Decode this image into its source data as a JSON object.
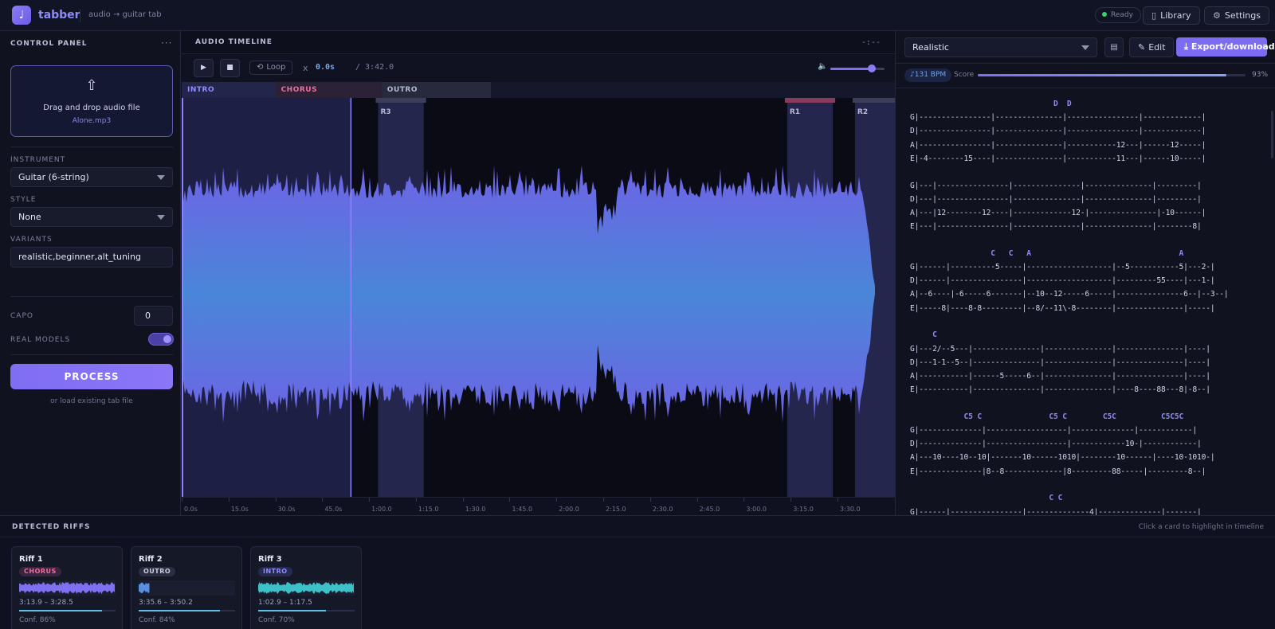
{
  "app": {
    "logo_glyph": "♩",
    "name": "tabber",
    "subtitle": "audio → guitar tab",
    "status": "Ready",
    "library_label": "Library",
    "settings_label": "Settings",
    "library_icon": "book-icon",
    "settings_icon": "gear-icon"
  },
  "control_panel": {
    "title": "CONTROL PANEL",
    "menu": "···",
    "dropzone_icon_glyph": "⇧",
    "dropzone_text": "Drag and drop audio file",
    "file_name": "Alone.mp3",
    "instrument_label": "INSTRUMENT",
    "instrument_value": "Guitar (6-string)",
    "style_label": "STYLE",
    "style_value": "None",
    "variants_label": "VARIANTS",
    "variants_value": "realistic,beginner,alt_tuning",
    "capo_label": "CAPO",
    "capo_value": "0",
    "real_models_label": "REAL MODELS",
    "real_models_on": true,
    "process_label": "PROCESS",
    "load_link": "or load existing tab file"
  },
  "timeline": {
    "title": "AUDIO TIMELINE",
    "timer": "-:--",
    "play_glyph": "▶",
    "stop_glyph": "■",
    "loop_label": "Loop",
    "multiplier": "x",
    "current_time": "0.0s",
    "duration": "/ 3:42.0",
    "volume_fraction": 0.76,
    "duration_seconds": 222,
    "sections": [
      {
        "label": "INTRO",
        "start": 0,
        "end": 30,
        "color": "#8e8cf8",
        "bg": "#23264a"
      },
      {
        "label": "CHORUS",
        "start": 30,
        "end": 64,
        "color": "#f06c9b",
        "bg": "#2b2238"
      },
      {
        "label": "OUTRO",
        "start": 64,
        "end": 99,
        "color": "#b4b8cf",
        "bg": "#262a3c"
      }
    ],
    "regions": [
      {
        "label": "R3",
        "start": 62.9,
        "end": 77.5
      },
      {
        "label": "R1",
        "start": 193.9,
        "end": 208.5
      },
      {
        "label": "R2",
        "start": 215.6,
        "end": 230.2
      }
    ],
    "selection": {
      "start": 0,
      "end": 54
    },
    "ticks": [
      "0.0s",
      "15.0s",
      "30.0s",
      "45.0s",
      "1:00.0",
      "1:15.0",
      "1:30.0",
      "1:45.0",
      "2:00.0",
      "2:15.0",
      "2:30.0",
      "2:45.0",
      "3:00.0",
      "3:15.0",
      "3:30.0"
    ]
  },
  "tab_panel": {
    "mode_value": "Realistic",
    "file_icon": "document-icon",
    "edit_label": "Edit",
    "export_label": "Export/download",
    "bpm": "♪131 BPM",
    "score_label": "Score",
    "score_fraction": 0.93,
    "score_value": "93%",
    "lines": [
      {
        "kind": "chord",
        "text": "                                D  D"
      },
      {
        "kind": "tab",
        "text": "G|----------------|---------------|----------------|-------------|"
      },
      {
        "kind": "tab",
        "text": "D|----------------|---------------|----------------|-------------|"
      },
      {
        "kind": "tab",
        "text": "A|----------------|---------------|-----------12---|------12-----|"
      },
      {
        "kind": "tab",
        "text": "E|-4--------15----|---------------|-----------11---|------10-----|"
      },
      {
        "kind": "blank",
        "text": ""
      },
      {
        "kind": "tab",
        "text": "G|---|----------------|---------------|---------------|---------|"
      },
      {
        "kind": "tab",
        "text": "D|---|----------------|---------------|---------------|---------|"
      },
      {
        "kind": "tab",
        "text": "A|---|12--------12----|-------------12-|---------------|-10------|"
      },
      {
        "kind": "tab",
        "text": "E|---|----------------|---------------|---------------|--------8|"
      },
      {
        "kind": "blank",
        "text": ""
      },
      {
        "kind": "chord",
        "text": "                  C   C   A                                 A"
      },
      {
        "kind": "tab",
        "text": "G|------|----------5-----|-------------------|--5-----------5|---2-|"
      },
      {
        "kind": "tab",
        "text": "D|------|----------------|-------------------|---------55----|---1-|"
      },
      {
        "kind": "tab",
        "text": "A|--6----|-6-----6-------|--10--12-----6-----|---------------6--|--3--|"
      },
      {
        "kind": "tab",
        "text": "E|-----8|----8-8---------|--8/--11\\-8--------|---------------|-----|"
      },
      {
        "kind": "blank",
        "text": ""
      },
      {
        "kind": "chord",
        "text": "     C"
      },
      {
        "kind": "tab",
        "text": "G|---2/--5---|---------------|---------------|---------------|----|"
      },
      {
        "kind": "tab",
        "text": "D|---1-1--5--|---------------|---------------|---------------|----|"
      },
      {
        "kind": "tab",
        "text": "A|-----------|------5-----6--|---------------|---------------|----|"
      },
      {
        "kind": "tab",
        "text": "E|-----------|---------------|---------------|----8----88---8|-8--|"
      },
      {
        "kind": "blank",
        "text": ""
      },
      {
        "kind": "chord",
        "text": "            C5 C               C5 C        C5C          C5C5C"
      },
      {
        "kind": "tab",
        "text": "G|--------------|------------------|--------------|------------|"
      },
      {
        "kind": "tab",
        "text": "D|--------------|------------------|------------10-|------------|"
      },
      {
        "kind": "tab",
        "text": "A|---10----10--10|-------10------1010|--------10------|----10-1010-|"
      },
      {
        "kind": "tab",
        "text": "E|--------------|8--8-------------|8---------88-----|---------8--|"
      },
      {
        "kind": "blank",
        "text": ""
      },
      {
        "kind": "chord",
        "text": "                               C C"
      },
      {
        "kind": "tab",
        "text": "G|------|----------------|--------------4|--------------|-------|"
      }
    ]
  },
  "riffs": {
    "title": "DETECTED RIFFS",
    "hint": "Click a card to highlight in timeline",
    "cards": [
      {
        "name": "Riff 1",
        "badge": "CHORUS",
        "badge_color": "#f06c9b",
        "badge_bg": "#3a2440",
        "wave_color": "#7e70f0",
        "wave_fill": 1.0,
        "range": "3:13.9 – 3:28.5",
        "confidence": 0.86,
        "conf_label": "Conf. 86%"
      },
      {
        "name": "Riff 2",
        "badge": "OUTRO",
        "badge_color": "#c9cce0",
        "badge_bg": "#2a2e40",
        "wave_color": "#5a8fe0",
        "wave_fill": 0.12,
        "range": "3:35.6 – 3:50.2",
        "confidence": 0.84,
        "conf_label": "Conf. 84%"
      },
      {
        "name": "Riff 3",
        "badge": "INTRO",
        "badge_color": "#8e8cf8",
        "badge_bg": "#262a50",
        "wave_color": "#3ec0c8",
        "wave_fill": 1.0,
        "range": "1:02.9 – 1:17.5",
        "confidence": 0.7,
        "conf_label": "Conf. 70%"
      }
    ]
  }
}
